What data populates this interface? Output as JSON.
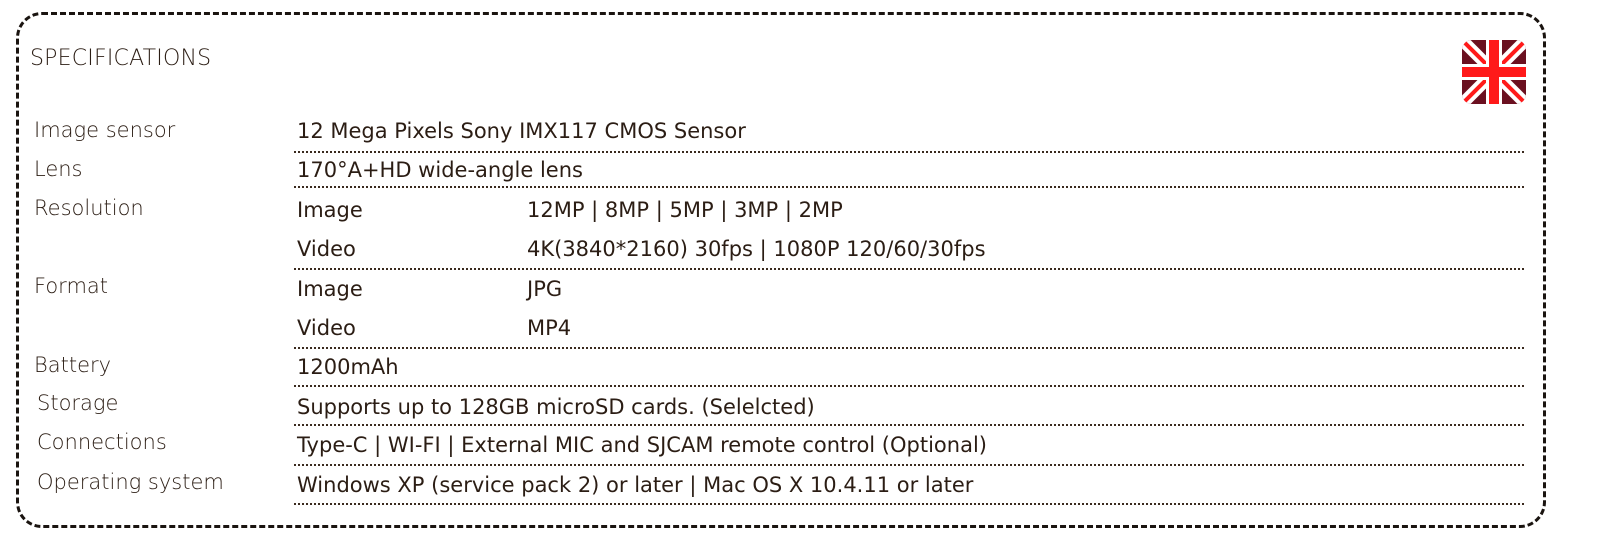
{
  "title": "SPECIFICATIONS",
  "flag_icon": "uk-flag-icon",
  "colors": {
    "text": "#2b1d14",
    "flag_red": "#ff1a1a",
    "flag_dark": "#6b1020",
    "border": "#1a1410"
  },
  "specs": [
    {
      "label": "Image sensor",
      "value": "12 Mega Pixels Sony IMX117 CMOS Sensor"
    },
    {
      "label": "Lens",
      "value": "170°A+HD wide-angle lens"
    },
    {
      "label": "Resolution",
      "sub": [
        {
          "name": "Image",
          "value": "12MP | 8MP | 5MP | 3MP | 2MP"
        },
        {
          "name": "Video",
          "value": "4K(3840*2160) 30fps | 1080P 120/60/30fps"
        }
      ]
    },
    {
      "label": "Format",
      "sub": [
        {
          "name": "Image",
          "value": "JPG"
        },
        {
          "name": "Video",
          "value": "MP4"
        }
      ]
    },
    {
      "label": "Battery",
      "value": "1200mAh"
    },
    {
      "label": "Storage",
      "value": "Supports up to 128GB microSD cards. (Selelcted)"
    },
    {
      "label": "Connections",
      "value": "Type-C | WI-FI | External MIC and SJCAM remote control (Optional)"
    },
    {
      "label": "Operating system",
      "value": "Windows XP (service pack 2) or later | Mac OS X 10.4.11 or later"
    }
  ]
}
